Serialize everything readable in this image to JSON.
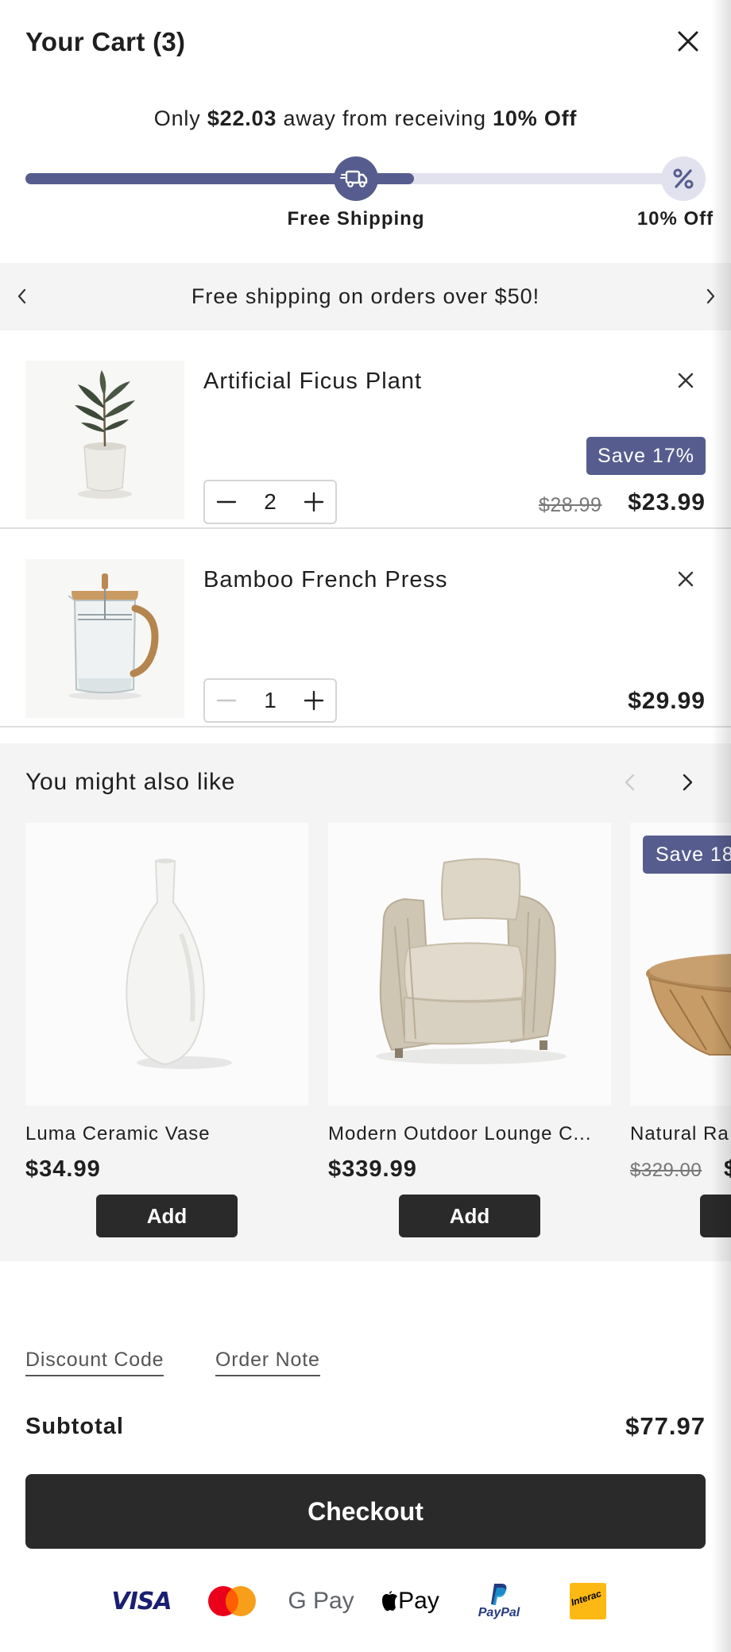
{
  "header": {
    "title": "Your Cart (3)"
  },
  "progress": {
    "message_prefix": "Only ",
    "amount_away": "$22.03",
    "message_middle": " away from receiving ",
    "reward": "10% Off",
    "fill_fraction": 0.59,
    "milestones": [
      {
        "label": "Free Shipping",
        "icon": "truck-icon"
      },
      {
        "label": "10% Off",
        "icon": "percent-icon"
      }
    ]
  },
  "announcement": {
    "text": "Free shipping on orders over $50!"
  },
  "cart_items": [
    {
      "name": "Artificial Ficus Plant",
      "quantity": "2",
      "badge": "Save 17%",
      "compare_price": "$28.99",
      "price": "$23.99"
    },
    {
      "name": "Bamboo French Press",
      "quantity": "1",
      "price": "$29.99"
    }
  ],
  "upsell": {
    "title": "You might also like",
    "items": [
      {
        "name": "Luma Ceramic Vase",
        "price": "$34.99",
        "add_label": "Add"
      },
      {
        "name": "Modern Outdoor Lounge C...",
        "price": "$339.99",
        "add_label": "Add"
      },
      {
        "name": "Natural Ra",
        "compare_price": "$329.00",
        "price": "$",
        "badge": "Save 18",
        "add_label": ""
      }
    ]
  },
  "footer": {
    "discount_link": "Discount Code",
    "note_link": "Order Note",
    "subtotal_label": "Subtotal",
    "subtotal_value": "$77.97",
    "checkout_label": "Checkout"
  },
  "payment_methods": {
    "visa": "VISA",
    "gpay": "G Pay",
    "apple_pay": "Pay",
    "paypal": "PayPal",
    "interac": "Interac"
  },
  "colors": {
    "accent": "#565d8e",
    "accent_light": "#e2e2ef",
    "button_dark": "#2a2a2a",
    "panel_gray": "#f4f4f4"
  }
}
